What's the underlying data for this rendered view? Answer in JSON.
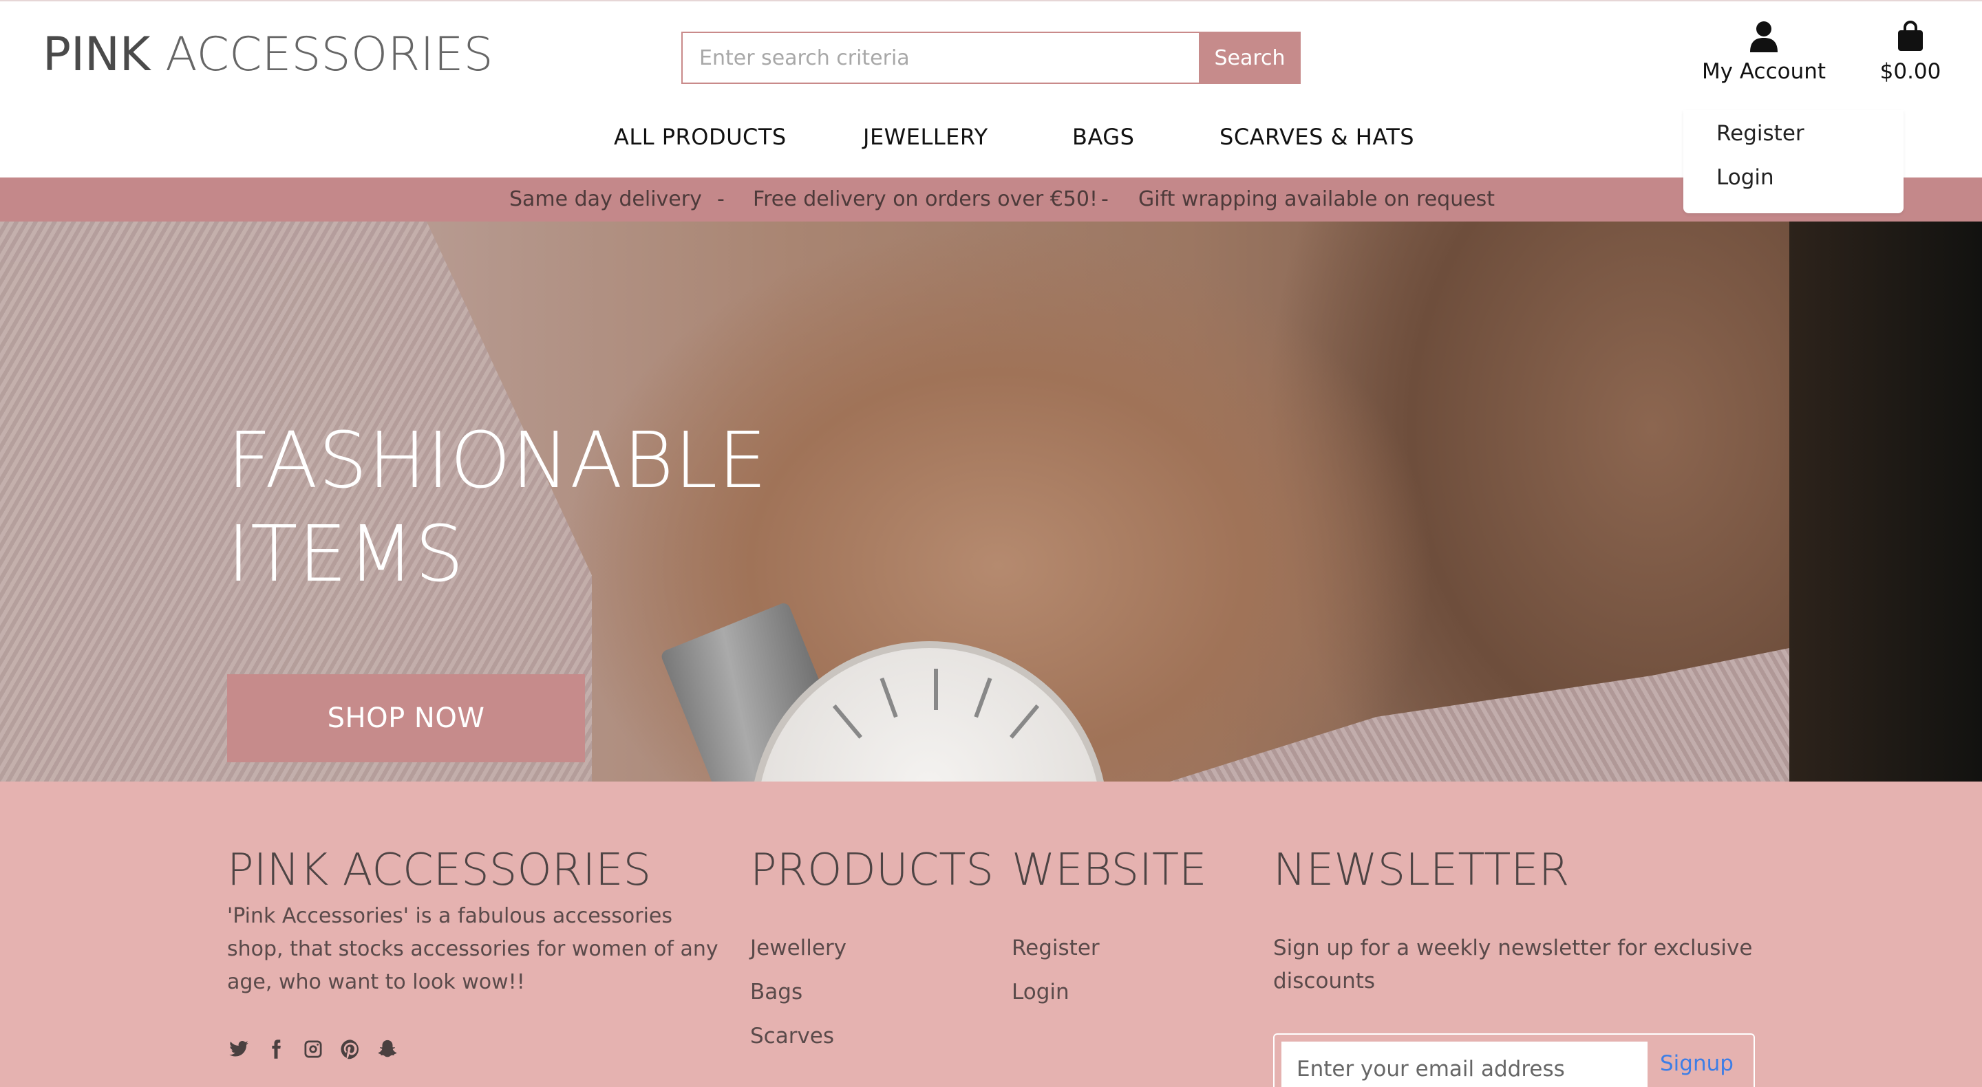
{
  "header": {
    "logo_bold": "PINK",
    "logo_light": " ACCESSORIES",
    "search": {
      "placeholder": "Enter search criteria",
      "button_label": "Search"
    },
    "account_label": "My Account",
    "cart_total": "$0.00"
  },
  "nav": {
    "items": [
      {
        "label": "ALL PRODUCTS"
      },
      {
        "label": "JEWELLERY"
      },
      {
        "label": "BAGS"
      },
      {
        "label": "SCARVES & HATS"
      }
    ]
  },
  "account_dropdown": {
    "items": [
      {
        "label": "Register"
      },
      {
        "label": "Login"
      }
    ]
  },
  "banner": {
    "messages": [
      "Same day delivery",
      "-",
      "Free delivery on orders over €50!",
      "-",
      "Gift wrapping available on request"
    ]
  },
  "hero": {
    "title_line1": "FASHIONABLE",
    "title_line2": "ITEMS",
    "cta_label": "SHOP NOW"
  },
  "footer": {
    "brand_bold": "PINK",
    "brand_light": " ACCESSORIES",
    "description": "'Pink Accessories' is a fabulous accessories shop, that stocks accessories for women of any age, who want to look wow!!",
    "social_icons": [
      "twitter-icon",
      "facebook-icon",
      "instagram-icon",
      "pinterest-icon",
      "snapchat-icon"
    ],
    "products": {
      "heading": "PRODUCTS",
      "links": [
        "Jewellery",
        "Bags",
        "Scarves"
      ]
    },
    "website": {
      "heading": "WEBSITE",
      "links": [
        "Register",
        "Login"
      ]
    },
    "newsletter": {
      "heading": "NEWSLETTER",
      "description": "Sign up for a weekly newsletter for exclusive discounts",
      "placeholder": "Enter your email address",
      "button_label": "Signup"
    }
  },
  "colors": {
    "accent": "#c68b8b",
    "banner": "#c4888a",
    "footer_bg": "#e5b2b0",
    "signup_link": "#3d7ee6"
  }
}
